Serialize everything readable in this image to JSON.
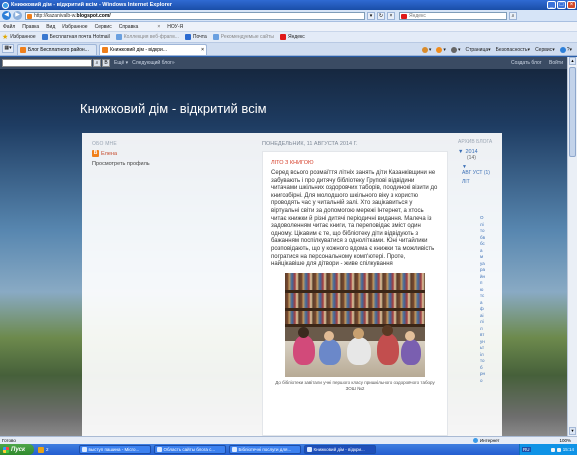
{
  "window": {
    "title": "Книжковий дім - відкритий всім - Windows Internet Explorer"
  },
  "address": {
    "url_prefix": "http://kazanivalb-w.",
    "url_domain": "blogspot.com/",
    "search_placeholder": "Яндекс"
  },
  "menu": {
    "items": [
      "Файл",
      "Правка",
      "Вид",
      "Избранное",
      "Сервис",
      "Справка"
    ],
    "bar_close": "×",
    "bar_label": "НОУ-Я"
  },
  "favorites": {
    "label": "Избранное",
    "items": [
      {
        "label": "Бесплатная почта Hotmail",
        "color": "#3a78d0"
      },
      {
        "label": "Коллекция веб-фрагм...",
        "color": "#6aa0e0"
      },
      {
        "label": "Почта",
        "color": "#2b6ad0"
      },
      {
        "label": "Рекомендуемые сайты",
        "color": "#6aa0e0"
      },
      {
        "label": "Яндекс",
        "color": "#e01818"
      }
    ]
  },
  "tabs": [
    {
      "label": "Блог Бесплатного район...",
      "active": false
    },
    {
      "label": "Книжковий дім - відкри...",
      "active": true
    }
  ],
  "commands": {
    "page": "Страница",
    "safety": "Безопасность",
    "service": "Сервис",
    "help": "?"
  },
  "blogbar": {
    "more": "Ещё",
    "next_blog": "Следующий блог»",
    "create_blog": "Создать блог",
    "sign_in": "Войти"
  },
  "blog": {
    "title": "Книжковий дім - відкритий всім"
  },
  "sidebar": {
    "about_heading": "ОБО МНЕ",
    "profile_name": "Елена",
    "profile_link": "Просмотреть профиль"
  },
  "post": {
    "date": "ПОНЕДЕЛЬНИК, 11 АВГУСТА 2014 Г.",
    "title": "ЛІТО З КНИГОЮ",
    "body": "Серед всього розмаїття літніх занять діти Казанківщини не забувають і про дитячу бібліотеку Групові відвідини читачами шкільних оздоровчих таборів, поодинокі візити до книгозбірні. Для молодшого шкільного віку з користю проводять час у читальній залі. Хто зацікавиться у віртуальні світи за допомогою мережі Інтернет, а хтось читає книжки й різні дитячі періодичні видання. Малеча із задоволенням читає книги, та переповідає зміст один одному. Цікавим є те, що бібліотеку діти відвідують з бажанням поспілкуватися з однолітками. Юні читайлики розповідають, що у кожного вдома є книжки та можливість погратися на персональному комп'ютері. Проте, найцікавіше для дітвори - живе спілкування",
    "photo_caption": "До бібліотеки завітали учні першого класу пришкільного оздоровчого табору ЗОШ №2"
  },
  "archive": {
    "heading": "АРХИВ БЛОГА",
    "year": "2014",
    "year_count": "(14)",
    "month": "АВГ УСТ (1)",
    "month_tail": "ЛІТ",
    "vertical_text": "Олітобвбсамуарайнпютсафаілілвтуньтілтобрно"
  },
  "status": {
    "text": "Готово",
    "zone": "Интернет",
    "zoom": "100%"
  },
  "taskbar": {
    "start": "Пуск",
    "quicklaunch": "2",
    "tasks": [
      {
        "label": "выступ пашина - Micro...",
        "active": false
      },
      {
        "label": "Область сайты блога с...",
        "active": false
      },
      {
        "label": "Бібліотечні послуги для...",
        "active": false
      },
      {
        "label": "Книжковий дім - відкри...",
        "active": true
      }
    ],
    "lang": "RU",
    "clock": "15:14"
  }
}
